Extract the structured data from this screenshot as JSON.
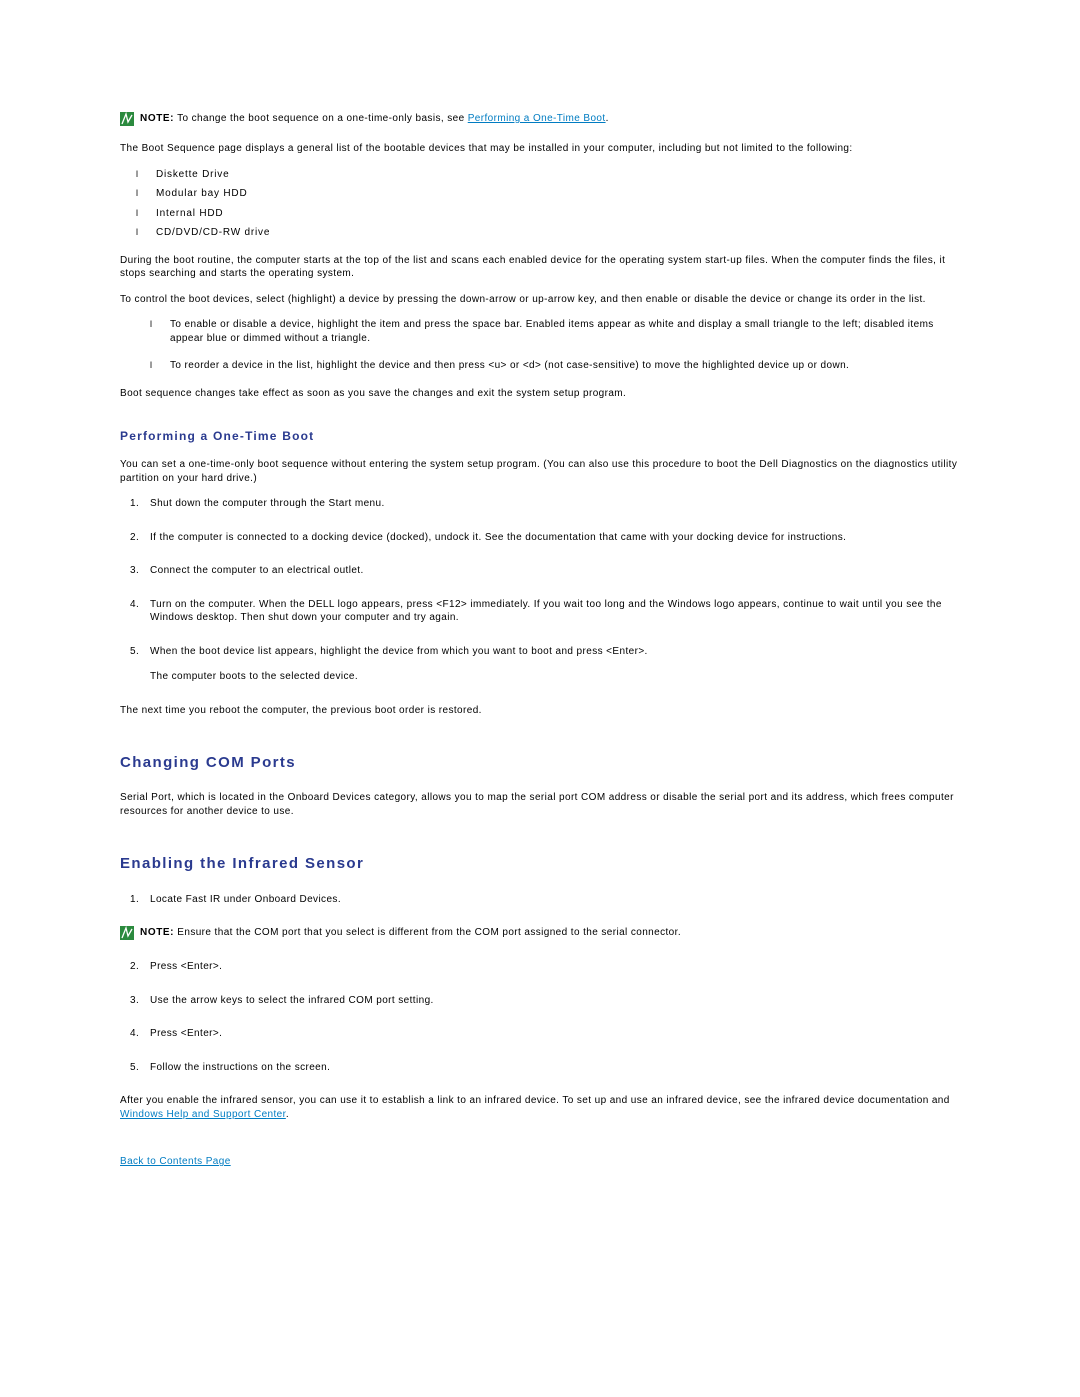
{
  "note1": {
    "label": "NOTE:",
    "text_before": " To change the boot sequence on a one-time-only basis, see ",
    "link": "Performing a One-Time Boot",
    "text_after": "."
  },
  "intro_para": "The Boot Sequence page displays a general list of the bootable devices that may be installed in your computer, including but not limited to the following:",
  "device_list": [
    "Diskette Drive",
    "Modular bay HDD",
    "Internal HDD",
    "CD/DVD/CD-RW drive"
  ],
  "boot_para1": "During the boot routine, the computer starts at the top of the list and scans each enabled device for the operating system start-up files. When the computer finds the files, it stops searching and starts the operating system.",
  "boot_para2": "To control the boot devices, select (highlight) a device by pressing the down-arrow or up-arrow key, and then enable or disable the device or change its order in the list.",
  "boot_sub_list": [
    "To enable or disable a device, highlight the item and press the space bar. Enabled items appear as white and display a small triangle to the left; disabled items appear blue or dimmed without a triangle.",
    "To reorder a device in the list, highlight the device and then press <u> or <d> (not case-sensitive) to move the highlighted device up or down."
  ],
  "boot_para3": "Boot sequence changes take effect as soon as you save the changes and exit the system setup program.",
  "one_time_heading": "Performing a One-Time Boot",
  "one_time_intro": "You can set a one-time-only boot sequence without entering the system setup program. (You can also use this procedure to boot the Dell Diagnostics on the diagnostics utility partition on your hard drive.)",
  "one_time_steps": [
    "Shut down the computer through the Start menu.",
    "If the computer is connected to a docking device (docked), undock it. See the documentation that came with your docking device for instructions.",
    "Connect the computer to an electrical outlet.",
    "Turn on the computer. When the DELL logo appears, press <F12> immediately. If you wait too long and the Windows logo appears, continue to wait until you see the Windows desktop. Then shut down your computer and try again.",
    "When the boot device list appears, highlight the device from which you want to boot and press <Enter>."
  ],
  "one_time_step5_sub": "The computer boots to the selected device.",
  "one_time_outro": "The next time you reboot the computer, the previous boot order is restored.",
  "com_heading": "Changing COM Ports",
  "com_para": "Serial Port, which is located in the Onboard Devices category, allows you to map the serial port COM address or disable the serial port and its address, which frees computer resources for another device to use.",
  "ir_heading": "Enabling the Infrared Sensor",
  "ir_steps_before_note": [
    "Locate Fast IR under Onboard Devices."
  ],
  "note2": {
    "label": "NOTE:",
    "text": " Ensure that the COM port that you select is different from the COM port assigned to the serial connector."
  },
  "ir_steps_after_note": [
    "Press <Enter>.",
    "Use the arrow keys to select the infrared COM port setting.",
    "Press <Enter>.",
    "Follow the instructions on the screen."
  ],
  "ir_outro_before": "After you enable the infrared sensor, you can use it to establish a link to an infrared device. To set up and use an infrared device, see the infrared device documentation and ",
  "ir_outro_link": "Windows Help and Support Center",
  "ir_outro_after": ".",
  "back_link": "Back to Contents Page"
}
